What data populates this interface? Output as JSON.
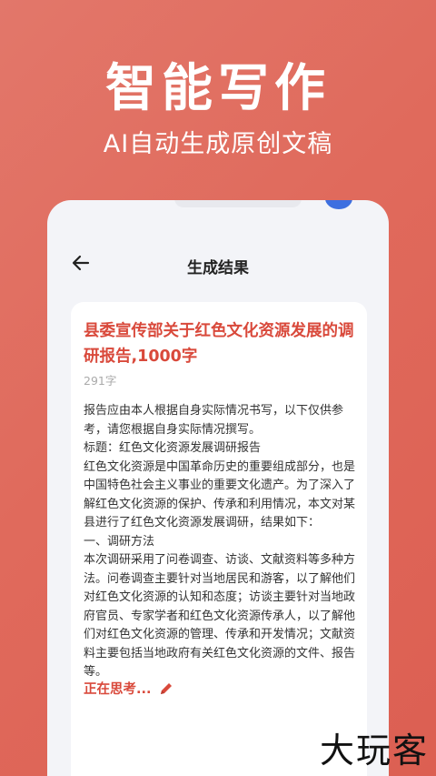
{
  "hero": {
    "title": "智能写作",
    "subtitle": "AI自动生成原创文稿"
  },
  "screen": {
    "nav_title": "生成结果",
    "back_icon": "arrow-left-icon",
    "document": {
      "title": "县委宣传部关于红色文化资源发展的调研报告,1000字",
      "word_count": "291字",
      "paragraphs": [
        "报告应由本人根据自身实际情况书写，以下仅供参考，请您根据自身实际情况撰写。",
        "标题：红色文化资源发展调研报告",
        "红色文化资源是中国革命历史的重要组成部分，也是中国特色社会主义事业的重要文化遗产。为了深入了解红色文化资源的保护、传承和利用情况，本文对某县进行了红色文化资源发展调研，结果如下：",
        "一、调研方法",
        "本次调研采用了问卷调查、访谈、文献资料等多种方法。问卷调查主要针对当地居民和游客，以了解他们对红色文化资源的认知和态度；访谈主要针对当地政府官员、专家学者和红色文化资源传承人，以了解他们对红色文化资源的管理、传承和开发情况；文献资料主要包括当地政府有关红色文化资源的文件、报告等。"
      ],
      "status": "正在思考...",
      "status_icon": "pencil-icon"
    }
  },
  "watermark": "大玩客",
  "colors": {
    "background": "#e06a5c",
    "accent": "#d9493b",
    "card": "#ffffff",
    "screen": "#f3f4f8"
  }
}
